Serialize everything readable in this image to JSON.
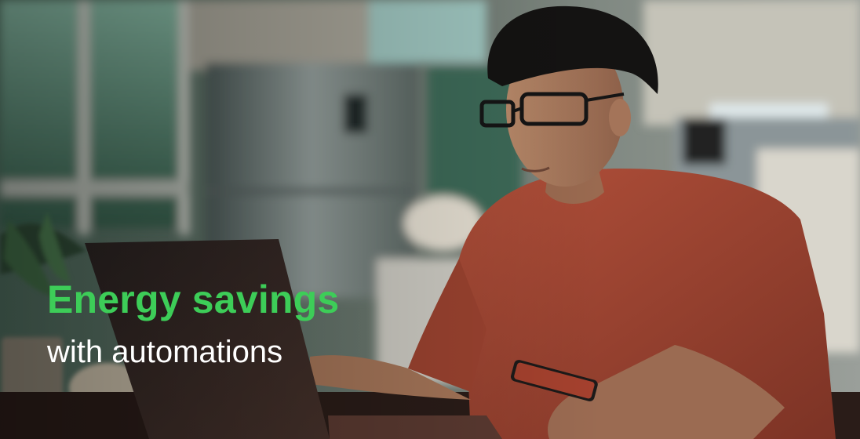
{
  "hero": {
    "headline": "Energy savings",
    "subline": "with automations"
  },
  "colors": {
    "headline": "#3dcd58",
    "subline": "#ffffff"
  }
}
